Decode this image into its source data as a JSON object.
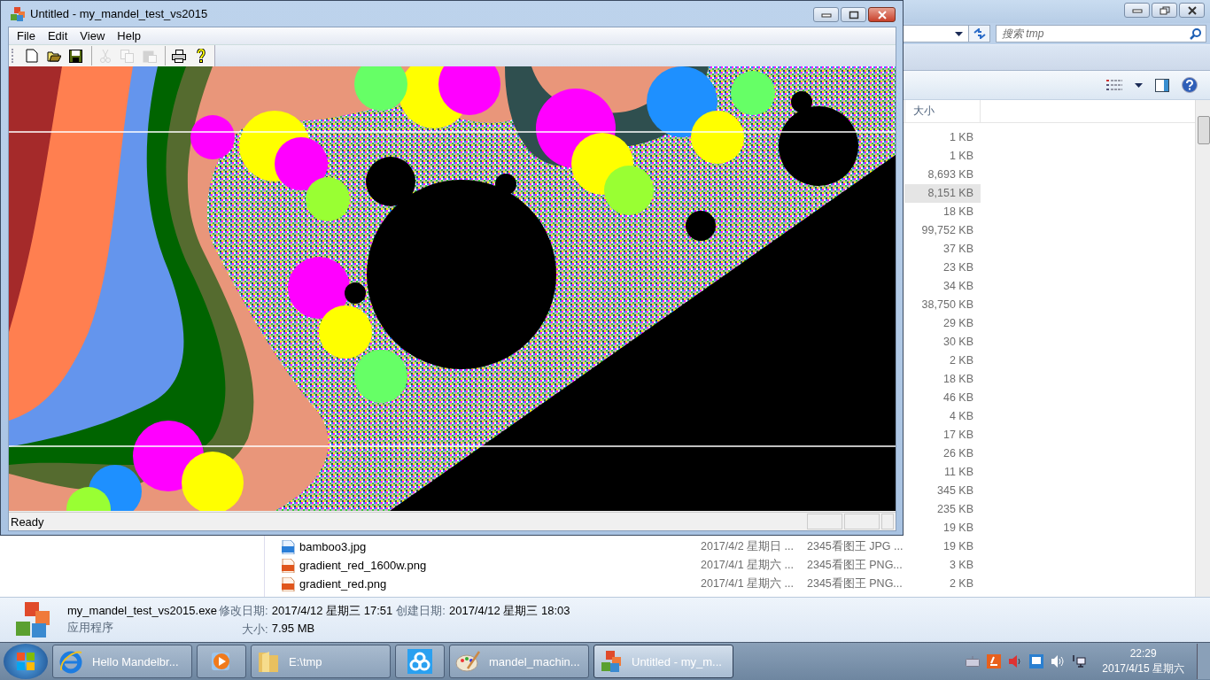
{
  "explorer": {
    "search": {
      "placeholder": "搜索 tmp"
    },
    "columns": [
      {
        "label": "大小"
      }
    ],
    "rows": [
      {
        "size": "1 KB",
        "selected": false
      },
      {
        "size": "1 KB",
        "selected": false
      },
      {
        "size": "8,693 KB",
        "selected": false
      },
      {
        "size": "8,151 KB",
        "selected": true
      },
      {
        "size": "18 KB",
        "selected": false
      },
      {
        "size": "99,752 KB",
        "selected": false
      },
      {
        "size": "37 KB",
        "selected": false
      },
      {
        "size": "23 KB",
        "selected": false
      },
      {
        "size": "34 KB",
        "selected": false
      },
      {
        "size": "38,750 KB",
        "selected": false
      },
      {
        "size": "29 KB",
        "selected": false
      },
      {
        "size": "30 KB",
        "selected": false
      },
      {
        "size": "2 KB",
        "selected": false
      },
      {
        "size": "18 KB",
        "selected": false
      },
      {
        "size": "46 KB",
        "selected": false
      },
      {
        "size": "4 KB",
        "selected": false
      },
      {
        "size": "17 KB",
        "selected": false
      },
      {
        "size": "26 KB",
        "selected": false
      },
      {
        "size": "11 KB",
        "selected": false
      },
      {
        "size": "345 KB",
        "selected": false
      },
      {
        "size": "235 KB",
        "selected": false
      },
      {
        "size": "19 KB",
        "selected": false
      },
      {
        "kind": "jpg",
        "name": "bamboo3.jpg",
        "date": "2017/4/2 星期日 ...",
        "type": "2345看图王 JPG ...",
        "size": "19 KB",
        "selected": false
      },
      {
        "kind": "png",
        "name": "gradient_red_1600w.png",
        "date": "2017/4/1 星期六 ...",
        "type": "2345看图王 PNG...",
        "size": "3 KB",
        "selected": false
      },
      {
        "kind": "png",
        "name": "gradient_red.png",
        "date": "2017/4/1 星期六 ...",
        "type": "2345看图王 PNG...",
        "size": "2 KB",
        "selected": false
      }
    ],
    "details": {
      "name": "my_mandel_test_vs2015.exe",
      "type": "应用程序",
      "modified_label": "修改日期:",
      "modified": "2017/4/12 星期三 17:51",
      "created_label": "创建日期:",
      "created": "2017/4/12 星期三 18:03",
      "size_label": "大小:",
      "size": "7.95 MB"
    }
  },
  "app_window": {
    "title": "Untitled - my_mandel_test_vs2015",
    "menu": [
      "File",
      "Edit",
      "View",
      "Help"
    ],
    "toolbar": [
      {
        "kind": "new",
        "disabled": false,
        "separator_before": false
      },
      {
        "kind": "open",
        "disabled": false,
        "separator_before": false
      },
      {
        "kind": "save",
        "disabled": false,
        "separator_before": false
      },
      {
        "kind": "cut",
        "disabled": true,
        "separator_before": true
      },
      {
        "kind": "copy",
        "disabled": true,
        "separator_before": false
      },
      {
        "kind": "paste",
        "disabled": true,
        "separator_before": false
      },
      {
        "kind": "print",
        "disabled": false,
        "separator_before": true
      },
      {
        "kind": "help",
        "disabled": false,
        "separator_before": false
      }
    ],
    "status_bar": "Ready"
  },
  "taskbar": {
    "items": [
      {
        "kind": "ie",
        "label": "Hello Mandelbr...",
        "active": false
      },
      {
        "kind": "media",
        "active": false
      },
      {
        "kind": "folder",
        "label": "E:\\tmp",
        "active": false
      },
      {
        "kind": "cloud",
        "active": false
      },
      {
        "kind": "paint",
        "label": "mandel_machin...",
        "active": false
      },
      {
        "kind": "mfc",
        "label": "Untitled - my_m...",
        "active": true
      }
    ],
    "clock": {
      "time": "22:29",
      "date": "2017/4/15 星期六"
    }
  }
}
